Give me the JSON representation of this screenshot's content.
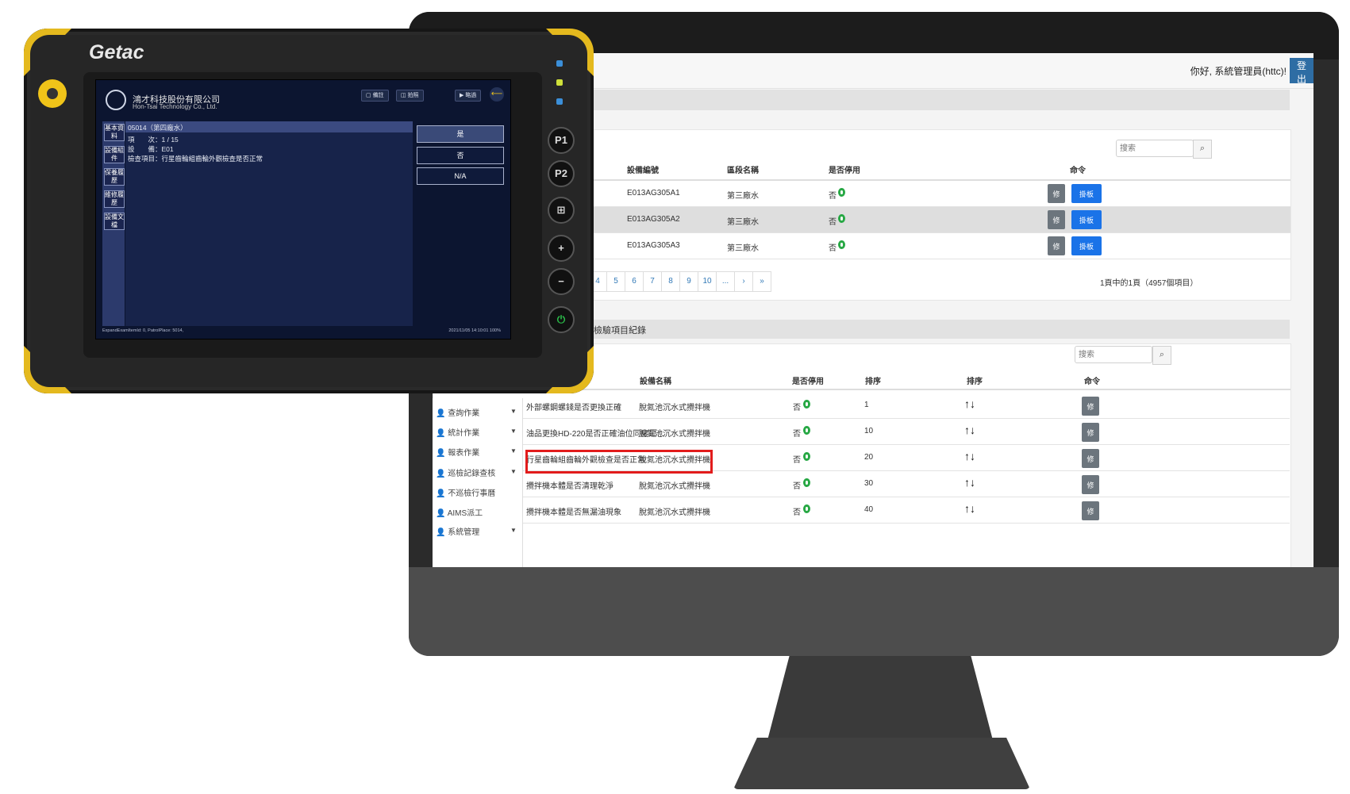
{
  "header": {
    "greeting": "你好, 系統管理員(httc)!",
    "logout_label": "登出"
  },
  "search": {
    "placeholder": "搜索",
    "icon": "search-icon"
  },
  "equipment_table": {
    "columns": [
      "設備編號",
      "區段名稱",
      "是否停用",
      "命令"
    ],
    "rows": [
      {
        "id": "E013AG305A1",
        "section": "第三廠水",
        "disabled": "否",
        "edit": "修改",
        "qr": "掛板證定"
      },
      {
        "id": "E013AG305A2",
        "section": "第三廠水",
        "disabled": "否",
        "edit": "修改",
        "qr": "掛板證定"
      },
      {
        "id": "E013AG305A3",
        "section": "第三廠水",
        "disabled": "否",
        "edit": "修改",
        "qr": "掛板證定"
      }
    ],
    "pagination": [
      "4",
      "5",
      "6",
      "7",
      "8",
      "9",
      "10",
      "...",
      "›",
      "»"
    ],
    "summary": "1頁中的1頁（4957個項目）"
  },
  "checklist": {
    "title": "的檢驗項目紀錄",
    "columns": [
      "設備名稱",
      "是否停用",
      "排序",
      "排序",
      "命令"
    ],
    "rows": [
      {
        "item": "外部螺鋼螺錢是否更換正確",
        "device": "脫氮池沉水式攪拌機",
        "disabled": "否",
        "order": "1",
        "edit": "修改"
      },
      {
        "item": "油品更換HD-220是否正確油位同度是…",
        "device": "脫氮池沉水式攪拌機",
        "disabled": "否",
        "order": "10",
        "edit": "修改"
      },
      {
        "item": "行星齒輪組齒輪外觀檢查是否正常",
        "device": "脫氮池沉水式攪拌機",
        "disabled": "否",
        "order": "20",
        "edit": "修改"
      },
      {
        "item": "攪拌機本體是否清理乾淨",
        "device": "脫氮池沉水式攪拌機",
        "disabled": "否",
        "order": "30",
        "edit": "修改"
      },
      {
        "item": "攪拌機本體是否無漏油現象",
        "device": "脫氮池沉水式攪拌機",
        "disabled": "否",
        "order": "40",
        "edit": "修改"
      }
    ],
    "sort_arrows": "↑↓"
  },
  "sidebar": {
    "items": [
      {
        "label": "查詢作業",
        "caret": "▼"
      },
      {
        "label": "統計作業",
        "caret": "▼"
      },
      {
        "label": "報表作業",
        "caret": "▼"
      },
      {
        "label": "巡檢記錄查核",
        "caret": "▼"
      },
      {
        "label": "不巡檢行事曆",
        "caret": ""
      },
      {
        "label": "AIMS派工",
        "caret": ""
      },
      {
        "label": "系統管理",
        "caret": "▼"
      }
    ]
  },
  "tablet": {
    "brand": "Getac",
    "company": "鴻才科技股份有限公司",
    "company_en": "Hon-Tsai Technology Co., Ltd.",
    "top_buttons": [
      "備註",
      "拍照",
      "略過"
    ],
    "side_tabs": [
      "基本資料",
      "設備組件",
      "保養履歷",
      "維修履歷",
      "設備文檔"
    ],
    "record_title": "05014（第四廠水）",
    "line_item": "項　　次：1 / 15",
    "line_device": "設　　備：E01",
    "line_check": "檢查項目：行星齒輪組齒輪外觀檢查是否正常",
    "options": [
      "是",
      "否",
      "N/A"
    ],
    "status_left": "ExpandExamItemId: 0, PatrolPlace: 5014,",
    "status_right": "2021/11/05  14:10:01  100%",
    "hw_buttons": [
      "P1",
      "P2",
      "⊞",
      "+",
      "−",
      "⏻"
    ]
  }
}
